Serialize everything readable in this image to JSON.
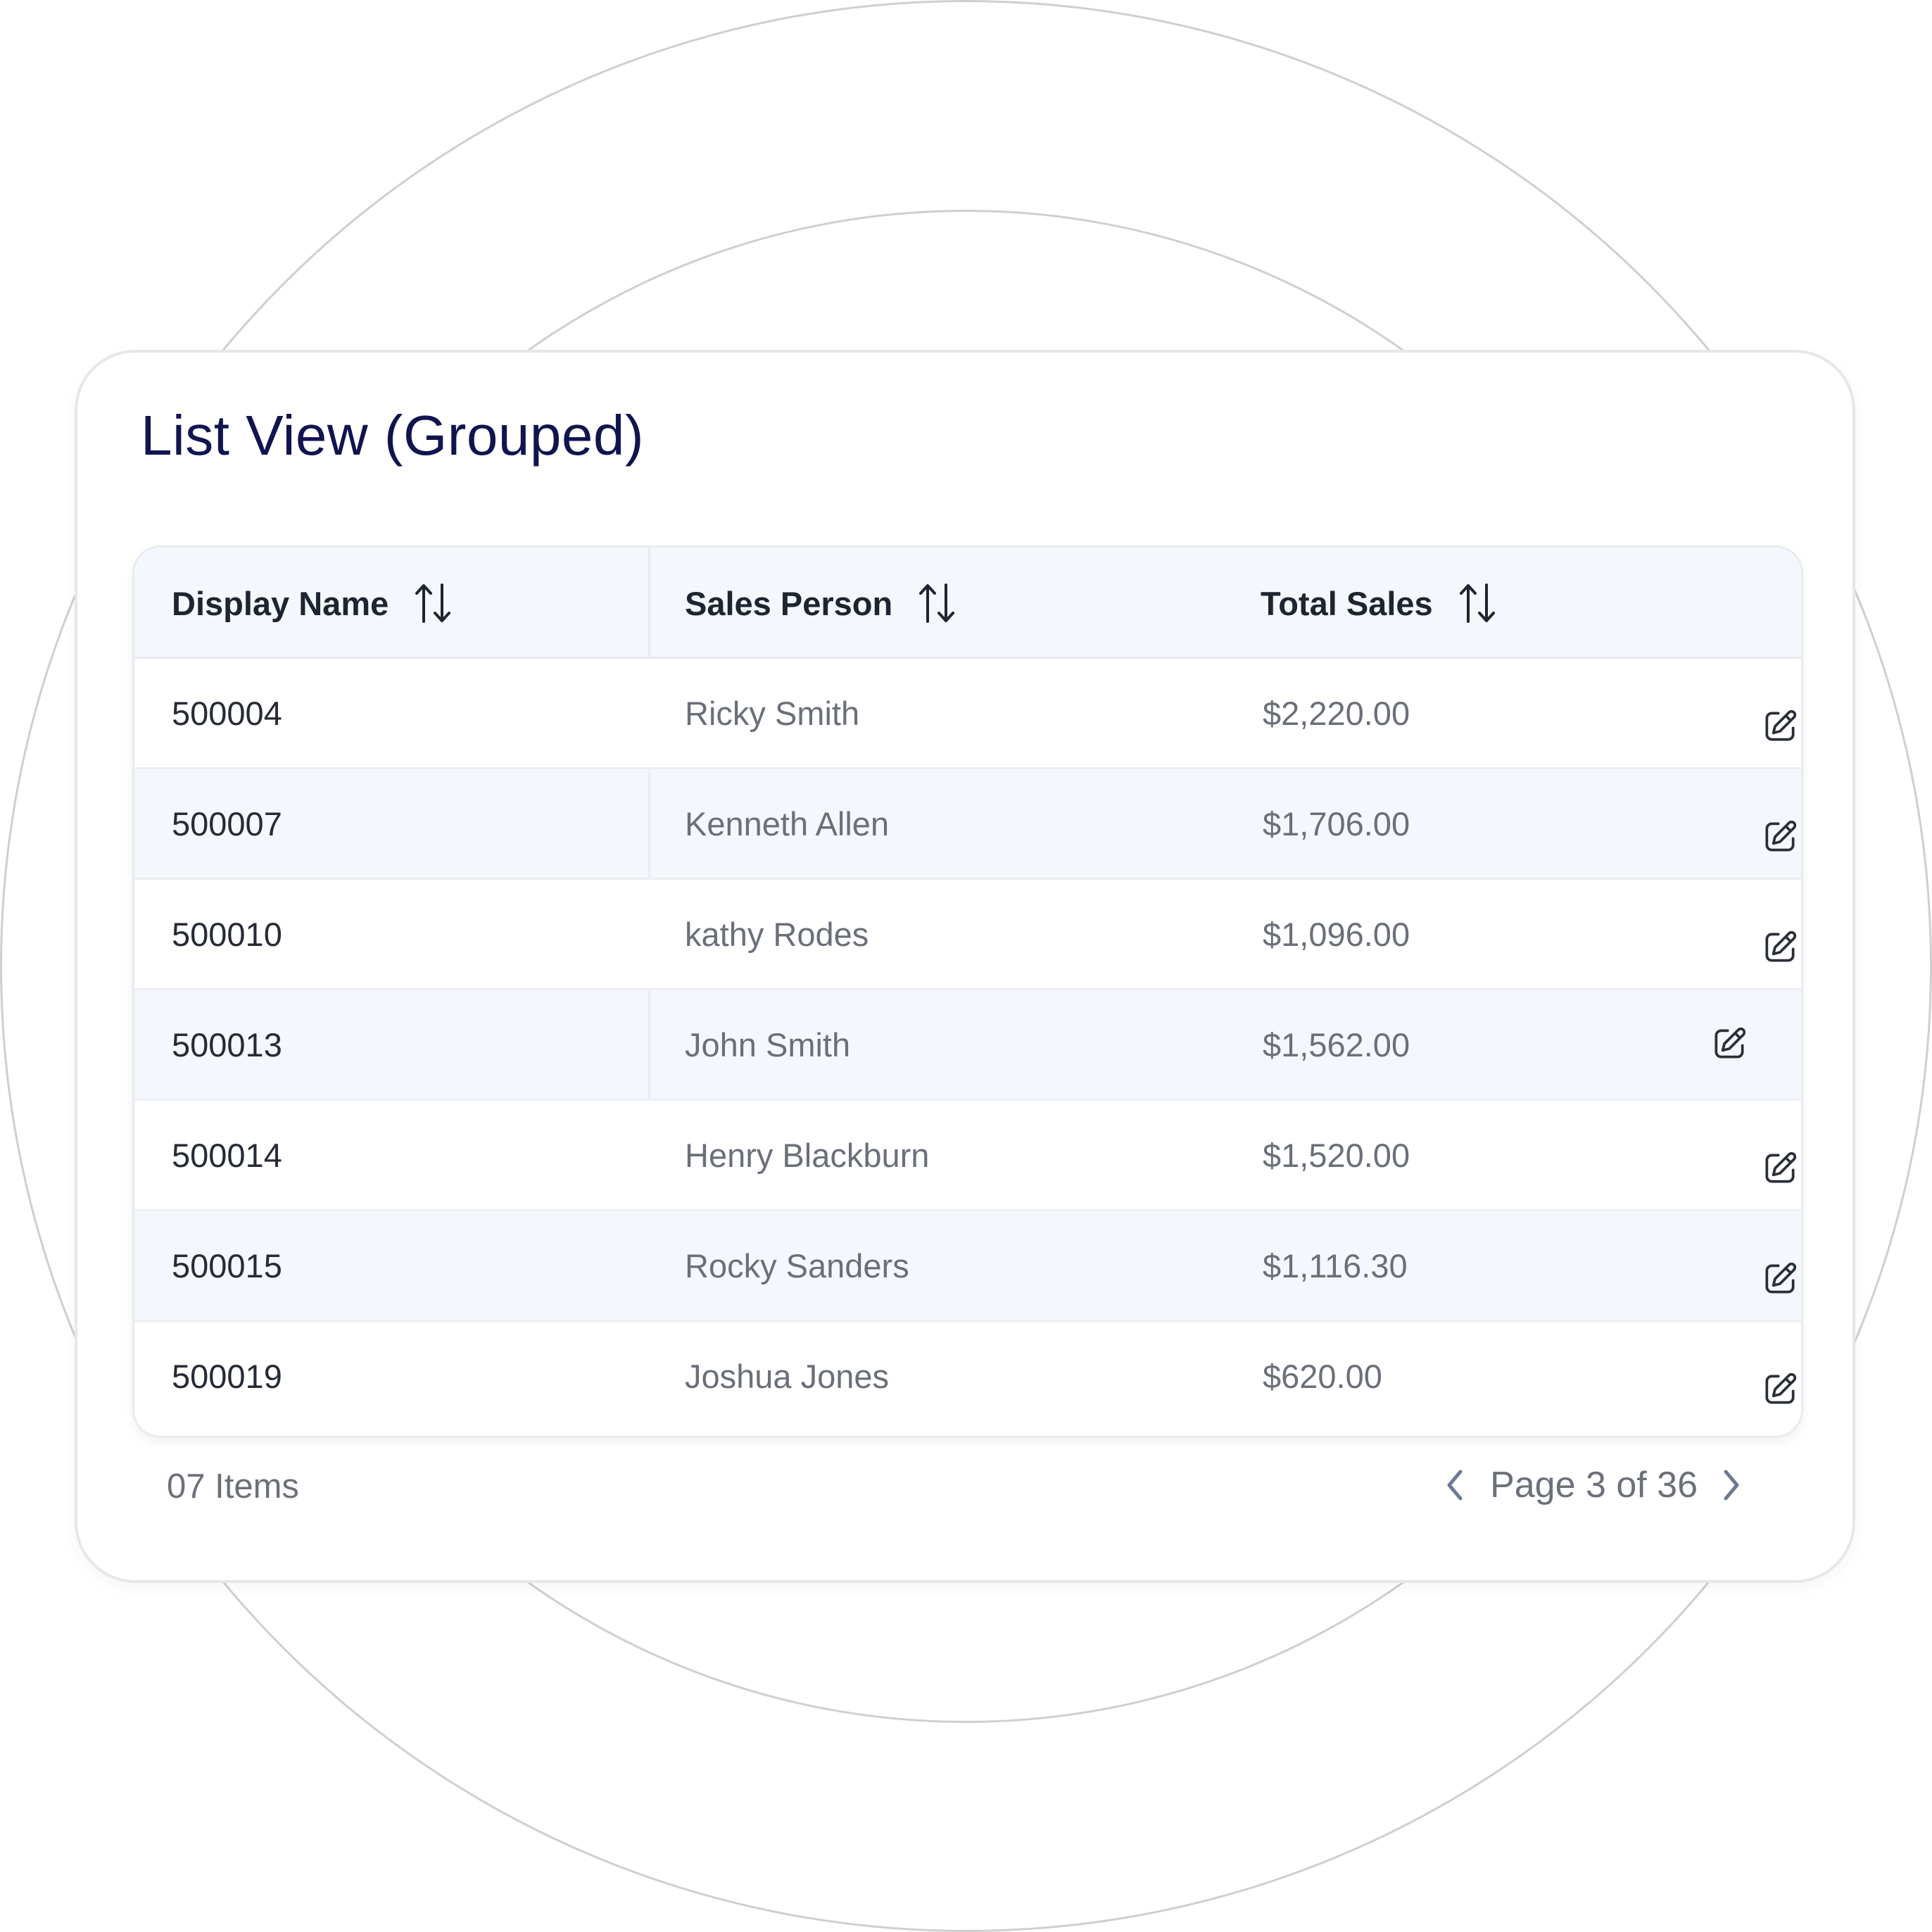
{
  "card": {
    "title": "List View (Grouped)"
  },
  "table": {
    "columns": [
      {
        "label": "Display Name",
        "sort_icon": "sort-arrows-icon"
      },
      {
        "label": "Sales Person",
        "sort_icon": "sort-arrows-icon"
      },
      {
        "label": "Total Sales",
        "sort_icon": "sort-arrows-icon"
      }
    ],
    "rows": [
      {
        "display_name": "500004",
        "sales_person": "Ricky Smith",
        "total_sales": "$2,220.00"
      },
      {
        "display_name": "500007",
        "sales_person": "Kenneth Allen",
        "total_sales": "$1,706.00"
      },
      {
        "display_name": "500010",
        "sales_person": "kathy Rodes",
        "total_sales": "$1,096.00"
      },
      {
        "display_name": "500013",
        "sales_person": "John Smith",
        "total_sales": "$1,562.00"
      },
      {
        "display_name": "500014",
        "sales_person": "Henry Blackburn",
        "total_sales": "$1,520.00"
      },
      {
        "display_name": "500015",
        "sales_person": "Rocky Sanders",
        "total_sales": "$1,116.30"
      },
      {
        "display_name": "500019",
        "sales_person": "Joshua Jones",
        "total_sales": "$620.00"
      }
    ],
    "row_action_icon": "edit-icon"
  },
  "footer": {
    "item_count": "07 Items",
    "page_label": "Page 3 of 36",
    "prev_icon": "chevron-left-icon",
    "next_icon": "chevron-right-icon"
  },
  "colors": {
    "title": "#10144f",
    "header_bg": "#f4f8fd",
    "alt_row_bg": "#f4f8fd",
    "text_primary": "#262b35",
    "text_secondary": "#6a6f78"
  }
}
